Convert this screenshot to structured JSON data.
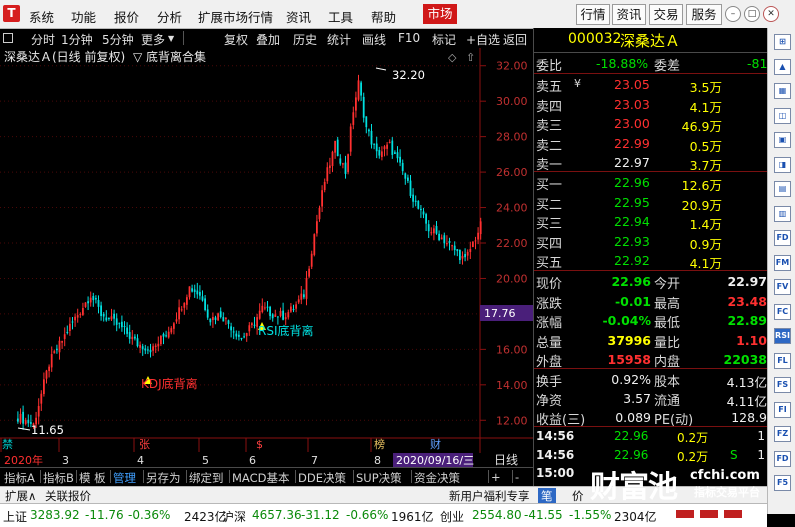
{
  "app": {
    "logo_text": "T",
    "menu": [
      "系统",
      "功能",
      "报价",
      "分析",
      "扩展市场行情",
      "资讯",
      "工具",
      "帮助"
    ],
    "market_button": "市场",
    "right_buttons": [
      "行情",
      "资讯",
      "交易",
      "服务"
    ]
  },
  "toolbar": {
    "items": [
      "分时",
      "1分钟",
      "5分钟",
      "更多",
      "复权",
      "叠加",
      "历史",
      "统计",
      "画线",
      "F10",
      "标记",
      "+自选",
      "返回"
    ]
  },
  "chart": {
    "title": "深桑达Ａ(日线 前复权)",
    "indicator": "底背离合集",
    "price_tag": "17.76",
    "date_tag": "2020/09/16/三",
    "period": "日线",
    "x_labels": [
      "2020年",
      "3",
      "4",
      "5",
      "6",
      "7",
      "8"
    ],
    "bottom_markers": [
      {
        "text": "禁",
        "color": "#00c8c8"
      },
      {
        "text": "张",
        "color": "#ff4040"
      },
      {
        "text": "$",
        "color": "#ff4040"
      },
      {
        "text": "榜",
        "color": "#e8c060"
      },
      {
        "text": "财",
        "color": "#60a0ff"
      }
    ],
    "annotations": {
      "high": "32.20",
      "low": "11.65",
      "kdj": "KDJ底背离",
      "rsi": "RSI底背离"
    }
  },
  "chart_data": {
    "type": "candlestick",
    "ylim": [
      11,
      33
    ],
    "y_ticks": [
      12.0,
      14.0,
      16.0,
      18.0,
      20.0,
      22.0,
      24.0,
      26.0,
      28.0,
      30.0,
      32.0
    ],
    "high": 32.2,
    "low": 11.65,
    "last": 22.96
  },
  "quote": {
    "code": "000032",
    "name": "深桑达Ａ",
    "wei_bi_label": "委比",
    "wei_bi": "-18.88%",
    "wei_cha_label": "委差",
    "wei_cha": "-81",
    "asks": [
      {
        "label": "卖五",
        "price": "23.05",
        "vol": "3.5万"
      },
      {
        "label": "卖四",
        "price": "23.03",
        "vol": "4.1万"
      },
      {
        "label": "卖三",
        "price": "23.00",
        "vol": "46.9万"
      },
      {
        "label": "卖二",
        "price": "22.99",
        "vol": "0.5万"
      },
      {
        "label": "卖一",
        "price": "22.97",
        "vol": "3.7万"
      }
    ],
    "currency": "¥",
    "bids": [
      {
        "label": "买一",
        "price": "22.96",
        "vol": "12.6万"
      },
      {
        "label": "买二",
        "price": "22.95",
        "vol": "20.9万"
      },
      {
        "label": "买三",
        "price": "22.94",
        "vol": "1.4万"
      },
      {
        "label": "买四",
        "price": "22.93",
        "vol": "0.9万"
      },
      {
        "label": "买五",
        "price": "22.92",
        "vol": "4.1万"
      }
    ],
    "stats_left": [
      {
        "label": "现价",
        "value": "22.96",
        "color": "grn"
      },
      {
        "label": "涨跌",
        "value": "-0.01",
        "color": "grn"
      },
      {
        "label": "涨幅",
        "value": "-0.04%",
        "color": "grn"
      },
      {
        "label": "总量",
        "value": "37996",
        "color": "yel"
      },
      {
        "label": "外盘",
        "value": "15958",
        "color": "red"
      }
    ],
    "stats_right": [
      {
        "label": "今开",
        "value": "22.97",
        "color": "wht"
      },
      {
        "label": "最高",
        "value": "23.48",
        "color": "red"
      },
      {
        "label": "最低",
        "value": "22.89",
        "color": "grn"
      },
      {
        "label": "量比",
        "value": "1.10",
        "color": "red"
      },
      {
        "label": "内盘",
        "value": "22038",
        "color": "grn"
      }
    ],
    "fin_left": [
      {
        "label": "换手",
        "value": "0.92%"
      },
      {
        "label": "净资",
        "value": "3.57"
      },
      {
        "label": "收益(三)",
        "value": "0.089"
      }
    ],
    "fin_right": [
      {
        "label": "股本",
        "value": "4.13亿"
      },
      {
        "label": "流通",
        "value": "4.11亿"
      },
      {
        "label": "PE(动)",
        "value": "128.9"
      }
    ],
    "ticks": [
      {
        "time": "14:56",
        "price": "22.96",
        "vol": "0.2万",
        "flag": "",
        "n": "1"
      },
      {
        "time": "14:56",
        "price": "22.96",
        "vol": "0.2万",
        "flag": "S",
        "n": "1"
      },
      {
        "time": "15:00",
        "price": "",
        "vol": "",
        "flag": "",
        "n": ""
      }
    ]
  },
  "tabs": [
    "指标A",
    "指标B",
    "模 板",
    "管理",
    "另存为",
    "绑定到",
    "MACD基本",
    "DDE决策",
    "SUP决策",
    "资金决策",
    "+",
    "-"
  ],
  "subbar": {
    "left": [
      "扩展∧",
      "关联报价"
    ],
    "right": [
      "新用户福利专享",
      "笔",
      "价"
    ]
  },
  "status": {
    "sh_label": "上证",
    "sh_value": "3283.92",
    "sh_chg": "-11.76",
    "sh_pct": "-0.36%",
    "sh_amt": "2423亿",
    "hs_label": "沪深",
    "hs_value": "4657.36",
    "hs_chg": "-31.12",
    "hs_pct": "-0.66%",
    "hs_amt": "1961亿",
    "cy_label": "创业",
    "cy_value": "2554.80",
    "cy_chg": "-41.55",
    "cy_pct": "-1.55%",
    "cy_amt": "2304亿"
  },
  "watermark": {
    "big": "财富池",
    "url": "cfchi.com",
    "small": "指标交易平台"
  },
  "sidebar_icons": [
    "⊞",
    "▲",
    "▦",
    "◫",
    "▣",
    "◨",
    "▤",
    "▥",
    "FD",
    "FM",
    "FV",
    "FC",
    "RSI",
    "FL",
    "FS",
    "FI",
    "FZ",
    "FD",
    "F5"
  ],
  "colors": {
    "up": "#ff3030",
    "down": "#00e0e0",
    "grid": "#7a1010",
    "accent": "#d01818",
    "price_tag_bg": "#4a1f7a"
  }
}
